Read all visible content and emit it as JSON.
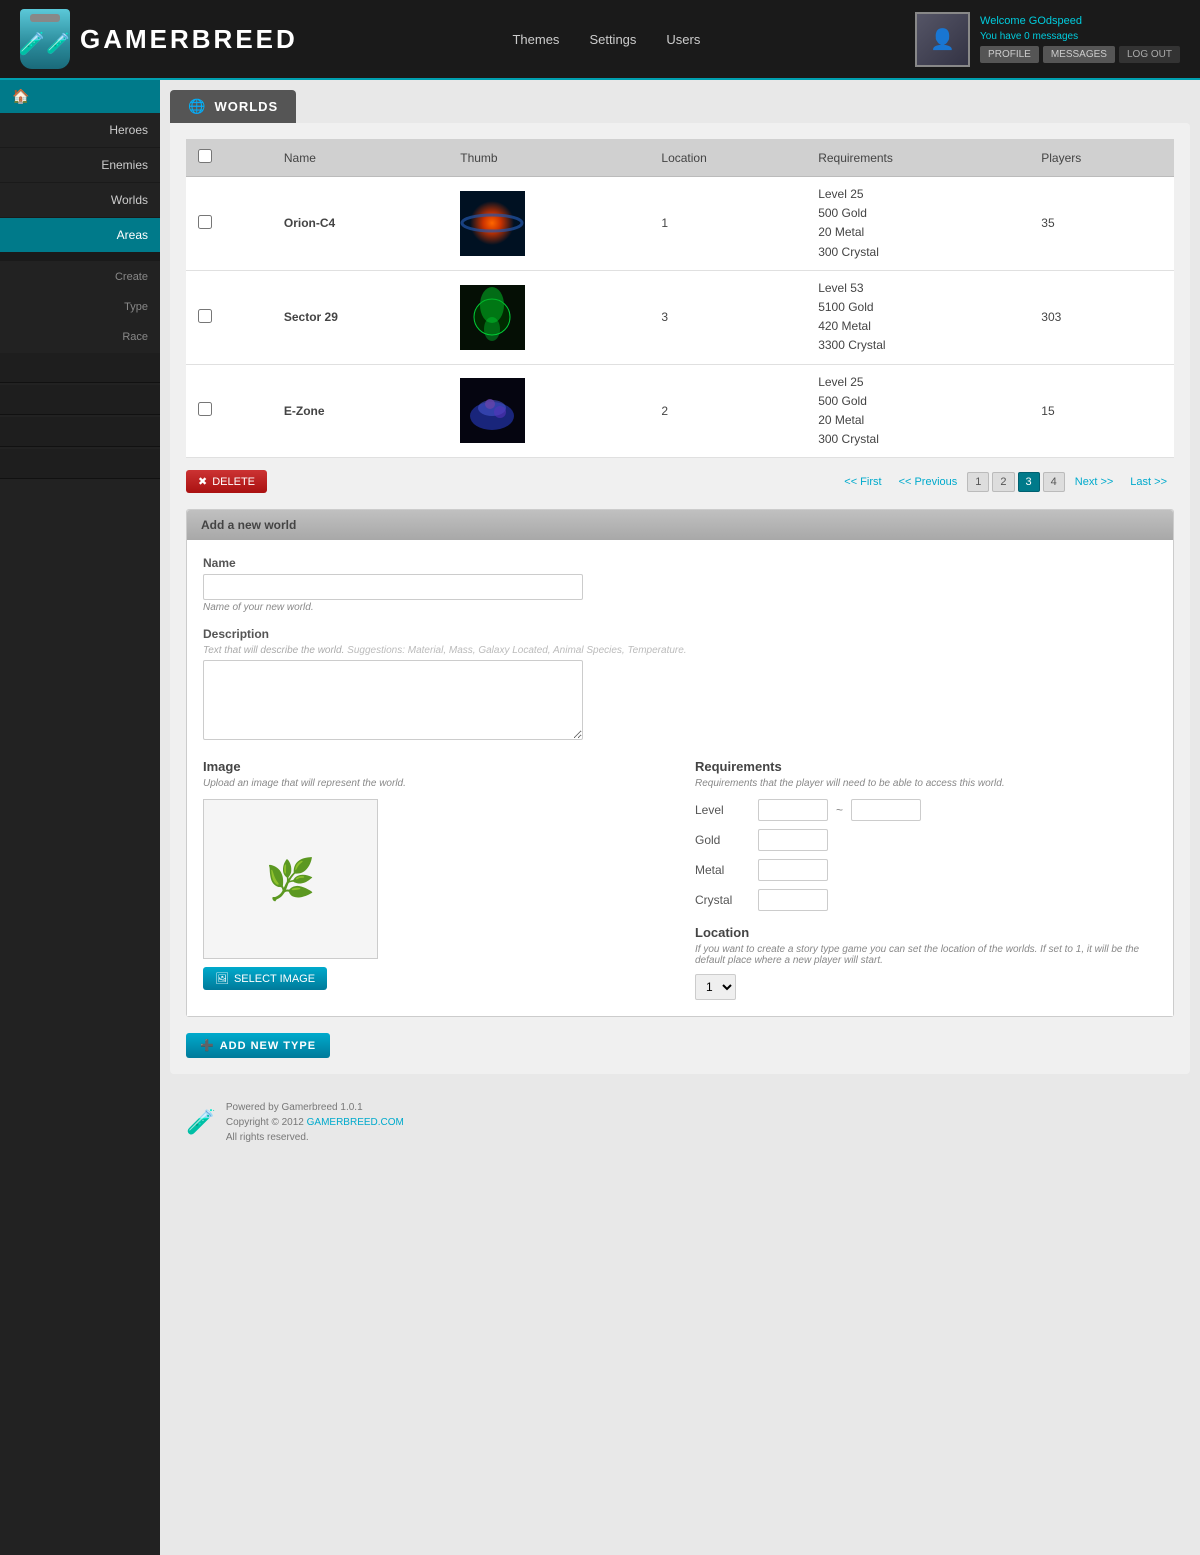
{
  "header": {
    "logo_text": "GAMERBREED",
    "nav": [
      "Themes",
      "Settings",
      "Users"
    ],
    "user": {
      "welcome": "Welcome",
      "username": "GOdspeed",
      "messages_text": "You have",
      "messages_count": "0",
      "messages_suffix": "messages",
      "btn_profile": "PROFILE",
      "btn_messages": "MESSAGES",
      "btn_logout": "LOG OUT"
    }
  },
  "sidebar": {
    "home_icon": "🏠",
    "items": [
      {
        "label": "Heroes",
        "active": false
      },
      {
        "label": "Enemies",
        "active": false
      },
      {
        "label": "Worlds",
        "active": false
      },
      {
        "label": "Areas",
        "active": true
      }
    ],
    "sub_items": [
      {
        "label": "Create"
      },
      {
        "label": "Type"
      },
      {
        "label": "Race"
      }
    ]
  },
  "page": {
    "tab_icon": "🌐",
    "tab_label": "WORLDS",
    "table": {
      "headers": [
        "",
        "Name",
        "Thumb",
        "Location",
        "Requirements",
        "Players"
      ],
      "rows": [
        {
          "name": "Orion-C4",
          "thumb_style": "orion",
          "location": "1",
          "requirements": "Level 25\n500 Gold\n20 Metal\n300 Crystal",
          "players": "35"
        },
        {
          "name": "Sector 29",
          "thumb_style": "sector",
          "location": "3",
          "requirements": "Level 53\n5100 Gold\n420 Metal\n3300 Crystal",
          "players": "303"
        },
        {
          "name": "E-Zone",
          "thumb_style": "ezone",
          "location": "2",
          "requirements": "Level 25\n500 Gold\n20 Metal\n300 Crystal",
          "players": "15"
        }
      ]
    },
    "pagination": {
      "delete_label": "DELETE",
      "first": "<< First",
      "prev": "<< Previous",
      "pages": [
        "1",
        "2",
        "3",
        "4"
      ],
      "active_page": "3",
      "next": "Next >>",
      "last": "Last >>"
    },
    "add_form": {
      "header": "Add a new world",
      "name_label": "Name",
      "name_placeholder": "",
      "name_hint": "Name of your new world.",
      "desc_label": "Description",
      "desc_hint": "Text that will describe the world.",
      "desc_suggestions": "Suggestions: Material, Mass, Galaxy Located, Animal Species, Temperature.",
      "image_label": "Image",
      "image_sublabel": "Upload an image that will represent the world.",
      "select_image_btn": "SELECT IMAGE",
      "req_label": "Requirements",
      "req_sublabel": "Requirements that the player will need to be able to access this world.",
      "level_label": "Level",
      "gold_label": "Gold",
      "metal_label": "Metal",
      "crystal_label": "Crystal",
      "level_value": "",
      "gold_value": "",
      "metal_value": "",
      "crystal_value": "",
      "location_label": "Location",
      "location_hint": "If you want to create a story type game you can set the location of the worlds. If set to 1, it will be the default place where a new player will start.",
      "location_value": "1"
    },
    "add_type_btn": "ADD NEW TYPE"
  },
  "footer": {
    "powered_by": "Powered by Gamerbreed 1.0.1",
    "copyright": "Copyright © 2012",
    "brand_link": "GAMERBREED.COM",
    "rights": "All rights reserved."
  }
}
